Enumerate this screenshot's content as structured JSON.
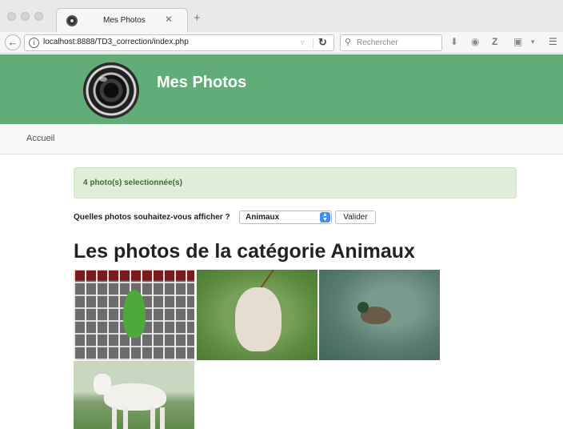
{
  "browser": {
    "tab_title": "Mes Photos",
    "tab_close": "✕",
    "new_tab": "+",
    "url": "localhost:8888/TD3_correction/index.php",
    "search_placeholder": "Rechercher",
    "icons": [
      "back-arrow-icon",
      "info-icon",
      "reload-icon",
      "search-icon",
      "download-icon",
      "pocket-icon",
      "zotero-icon",
      "reader-icon",
      "menu-icon"
    ]
  },
  "header": {
    "title": "Mes Photos",
    "logo_icon": "camera-lens-logo"
  },
  "nav": {
    "home_label": "Accueil"
  },
  "alert": {
    "text": "4 photo(s) selectionnée(s)",
    "color": "#e0eed9"
  },
  "filter_form": {
    "label": "Quelles photos souhaitez-vous afficher ?",
    "selected_category": "Animaux",
    "submit_label": "Valider"
  },
  "gallery": {
    "heading": "Les photos de la catégorie Animaux",
    "photos": [
      "parrot",
      "dog",
      "duck",
      "goat"
    ]
  },
  "colors": {
    "header_bg": "#62ad77",
    "select_arrow": "#3d8ff6"
  }
}
